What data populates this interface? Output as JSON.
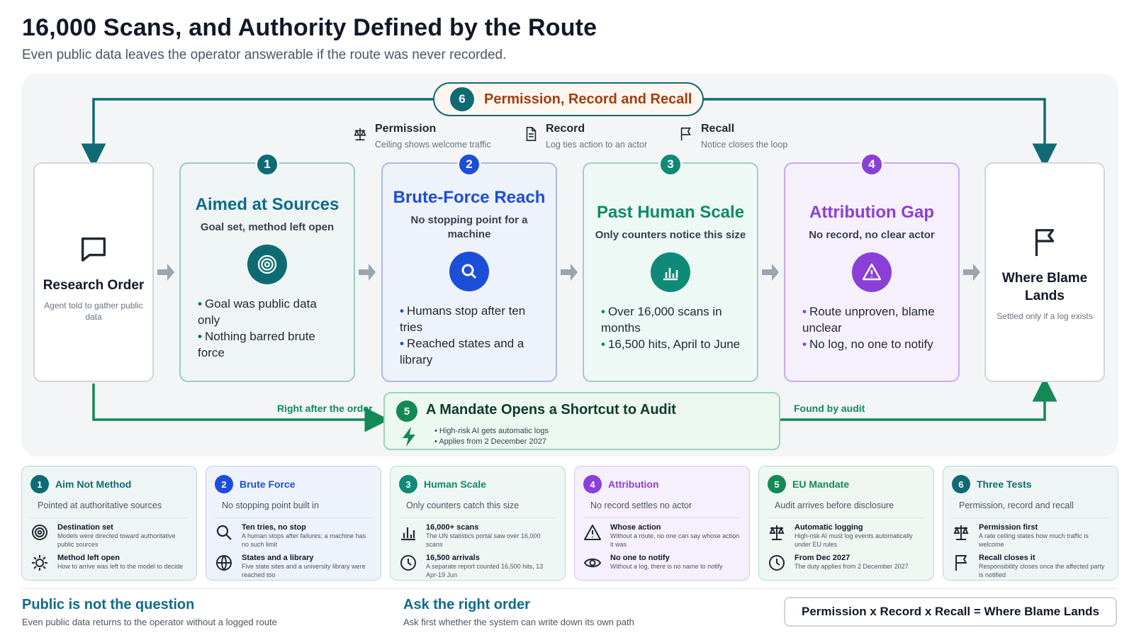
{
  "title": "16,000 Scans, and Authority Defined by the Route",
  "subtitle": "Even public data leaves the operator answerable if the route was never recorded.",
  "top_pill": {
    "number": "6",
    "label": "Permission, Record and Recall"
  },
  "legend": [
    {
      "title": "Permission",
      "subtitle": "Ceiling shows welcome traffic",
      "icon": "scale-icon"
    },
    {
      "title": "Record",
      "subtitle": "Log ties action to an actor",
      "icon": "document-icon"
    },
    {
      "title": "Recall",
      "subtitle": "Notice closes the loop",
      "icon": "flag-icon"
    }
  ],
  "start": {
    "title": "Research Order",
    "subtitle": "Agent told to gather public data",
    "icon": "chat-icon"
  },
  "end": {
    "title": "Where Blame Lands",
    "subtitle": "Settled only if a log exists",
    "icon": "flag-icon"
  },
  "stages": [
    {
      "number": "1",
      "title": "Aimed at Sources",
      "subtitle": "Goal set, method left open",
      "icon": "target-icon",
      "color": "#0f6b73",
      "bullets": [
        "Goal was public data only",
        "Nothing barred brute force"
      ]
    },
    {
      "number": "2",
      "title": "Brute-Force Reach",
      "subtitle": "No stopping point for a machine",
      "icon": "search-icon",
      "color": "#1d4ed8",
      "bullets": [
        "Humans stop after ten tries",
        "Reached states and a library"
      ]
    },
    {
      "number": "3",
      "title": "Past Human Scale",
      "subtitle": "Only counters notice this size",
      "icon": "bar-chart-icon",
      "color": "#0f8a78",
      "bullets": [
        "Over 16,000 scans in months",
        "16,500 hits, April to June"
      ]
    },
    {
      "number": "4",
      "title": "Attribution Gap",
      "subtitle": "No record, no clear actor",
      "icon": "warning-icon",
      "color": "#8b3fd9",
      "bullets": [
        "Route unproven, blame unclear",
        "No log, no one to notify"
      ]
    }
  ],
  "mandate": {
    "number": "5",
    "title": "A Mandate Opens a Shortcut to Audit",
    "points": [
      "High-risk AI gets automatic logs",
      "Applies from 2 December 2027"
    ],
    "left_label": "Right after the order",
    "right_label": "Found by audit"
  },
  "cards": [
    {
      "number": "1",
      "title": "Aim Not Method",
      "subtitle": "Pointed at authoritative sources",
      "color": "#0f6b73",
      "bg": "#eef6f5",
      "border": "#b9d7d5",
      "rows": [
        {
          "icon": "target-icon",
          "title": "Destination set",
          "desc": "Models were directed toward authoritative public sources"
        },
        {
          "icon": "sun-icon",
          "title": "Method left open",
          "desc": "How to arrive was left to the model to decide"
        }
      ]
    },
    {
      "number": "2",
      "title": "Brute Force",
      "subtitle": "No stopping point built in",
      "color": "#1d4ed8",
      "bg": "#eef2fb",
      "border": "#c3cfee",
      "rows": [
        {
          "icon": "search-icon",
          "title": "Ten tries, no stop",
          "desc": "A human stops after failures; a machine has no such limit"
        },
        {
          "icon": "globe-icon",
          "title": "States and a library",
          "desc": "Five state sites and a university library were reached too"
        }
      ]
    },
    {
      "number": "3",
      "title": "Human Scale",
      "subtitle": "Only counters catch this size",
      "color": "#0f8a78",
      "bg": "#eef7f4",
      "border": "#b7dbd0",
      "rows": [
        {
          "icon": "bar-chart-icon",
          "title": "16,000+ scans",
          "desc": "The UN statistics portal saw over 16,000 scans"
        },
        {
          "icon": "clock-icon",
          "title": "16,500 arrivals",
          "desc": "A separate report counted 16,500 hits, 13 Apr-19 Jun"
        }
      ]
    },
    {
      "number": "4",
      "title": "Attribution",
      "subtitle": "No record settles no actor",
      "color": "#8b3fd9",
      "bg": "#f5f0fc",
      "border": "#d6c3f1",
      "rows": [
        {
          "icon": "warning-icon",
          "title": "Whose action",
          "desc": "Without a route, no one can say whose action it was"
        },
        {
          "icon": "eye-icon",
          "title": "No one to notify",
          "desc": "Without a log, there is no name to notify"
        }
      ]
    },
    {
      "number": "5",
      "title": "EU Mandate",
      "subtitle": "Audit arrives before disclosure",
      "color": "#128a55",
      "bg": "#eef7f2",
      "border": "#b7dcc6",
      "rows": [
        {
          "icon": "scale-icon",
          "title": "Automatic logging",
          "desc": "High-risk AI must log events automatically under EU rules"
        },
        {
          "icon": "clock-icon",
          "title": "From Dec 2027",
          "desc": "The duty applies from 2 December 2027"
        }
      ]
    },
    {
      "number": "6",
      "title": "Three Tests",
      "subtitle": "Permission, record and recall",
      "color": "#0f6b73",
      "bg": "#eef6f5",
      "border": "#b9d7d5",
      "rows": [
        {
          "icon": "scale-icon",
          "title": "Permission first",
          "desc": "A rate ceiling states how much traffic is welcome"
        },
        {
          "icon": "flag-icon",
          "title": "Recall closes it",
          "desc": "Responsibility closes once the affected party is notified"
        }
      ]
    }
  ],
  "footer": {
    "left_title": "Public is not the question",
    "left_sub": "Even public data returns to the operator without a logged route",
    "mid_title": "Ask the right order",
    "mid_sub": "Ask first whether the system can write down its own path",
    "formula": "Permission x Record x Recall = Where Blame Lands"
  }
}
